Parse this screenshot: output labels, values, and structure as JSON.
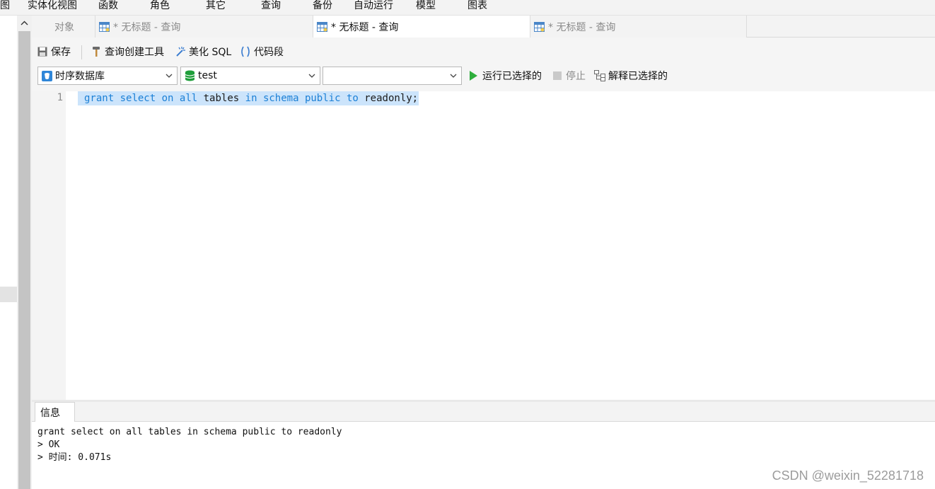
{
  "menu": {
    "items": [
      "图",
      "实体化视图",
      "函数",
      "角色",
      "其它",
      "查询",
      "备份",
      "自动运行",
      "模型",
      "图表"
    ]
  },
  "tabs": [
    {
      "label": "对象",
      "state": "inactive"
    },
    {
      "label": "* 无标题 - 查询",
      "state": "inactive"
    },
    {
      "label": "* 无标题 - 查询",
      "state": "active"
    },
    {
      "label": "* 无标题 - 查询",
      "state": "inactive"
    }
  ],
  "toolbar": {
    "save_label": "保存",
    "query_builder_label": "查询创建工具",
    "beautify_label": "美化 SQL",
    "snippet_label": "代码段"
  },
  "selectors": {
    "connection_value": "时序数据库",
    "database_value": "test",
    "schema_value": "",
    "run_selected_label": "运行已选择的",
    "stop_label": "停止",
    "explain_label": "解释已选择的"
  },
  "editor": {
    "line_number": "1",
    "tokens": [
      {
        "text": "grant",
        "kind": "kw"
      },
      {
        "text": " ",
        "kind": "plain"
      },
      {
        "text": "select",
        "kind": "kw"
      },
      {
        "text": " ",
        "kind": "plain"
      },
      {
        "text": "on",
        "kind": "kw"
      },
      {
        "text": " ",
        "kind": "plain"
      },
      {
        "text": "all",
        "kind": "kw"
      },
      {
        "text": " tables ",
        "kind": "plain"
      },
      {
        "text": "in",
        "kind": "kw"
      },
      {
        "text": " ",
        "kind": "plain"
      },
      {
        "text": "schema",
        "kind": "kw"
      },
      {
        "text": " ",
        "kind": "plain"
      },
      {
        "text": "public",
        "kind": "kw"
      },
      {
        "text": " ",
        "kind": "plain"
      },
      {
        "text": "to",
        "kind": "kw"
      },
      {
        "text": " readonly;",
        "kind": "plain"
      }
    ]
  },
  "results": {
    "tab_label": "信息",
    "lines": [
      "grant select on all tables in schema public to readonly",
      "> OK",
      "> 时间: 0.071s"
    ]
  },
  "watermark": "CSDN @weixin_52281718",
  "colors": {
    "keyword": "#1c80d6",
    "selection": "#cce4fb",
    "run_green": "#2eae3c",
    "db_green": "#1f9e3a",
    "connection_blue": "#2f86d8"
  }
}
